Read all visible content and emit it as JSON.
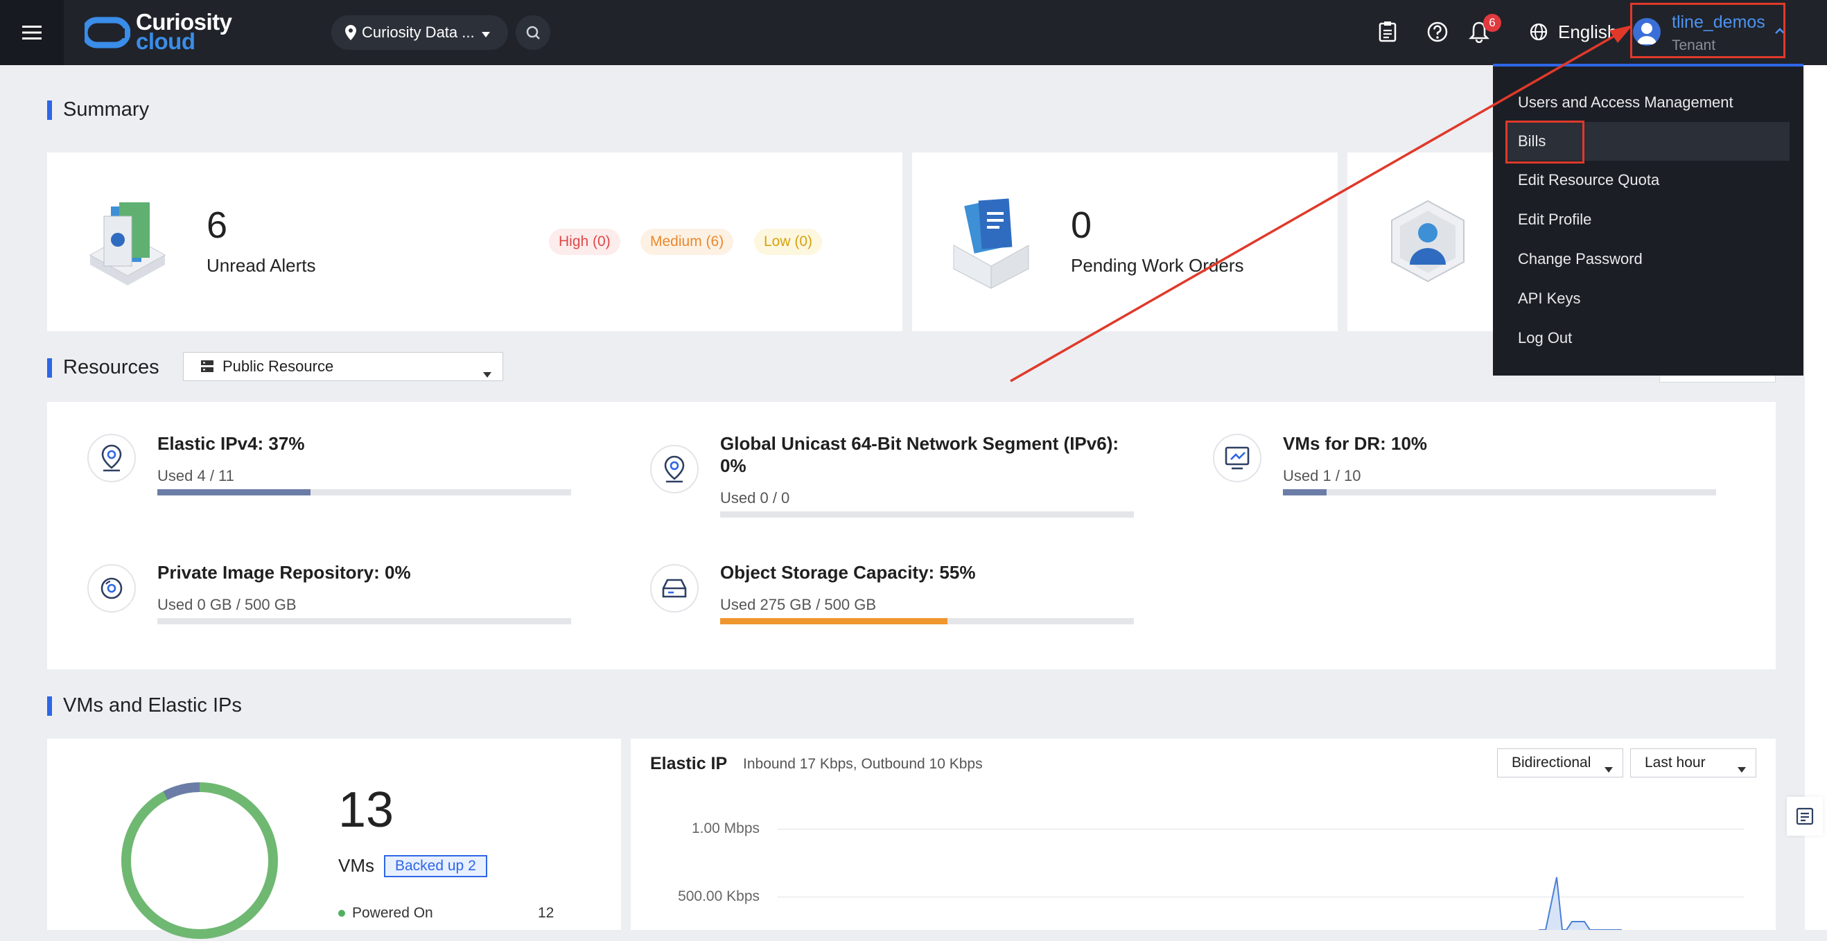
{
  "header": {
    "logo_line1": "Curiosity",
    "logo_line2": "cloud",
    "region": "Curiosity Data ...",
    "notification_count": "6",
    "language": "English",
    "user": {
      "name": "tline_demos",
      "role": "Tenant"
    }
  },
  "user_menu": {
    "items": [
      "Users and Access Management",
      "Bills",
      "Edit Resource Quota",
      "Edit Profile",
      "Change Password",
      "API Keys",
      "Log Out"
    ],
    "highlighted": "Bills"
  },
  "summary": {
    "title": "Summary",
    "alerts": {
      "count": "6",
      "label": "Unread Alerts",
      "high": "High (0)",
      "medium": "Medium (6)",
      "low": "Low (0)"
    },
    "work_orders": {
      "count": "0",
      "label": "Pending Work Orders"
    }
  },
  "resources": {
    "title": "Resources",
    "filter": "Public Resource",
    "items": [
      {
        "title": "Elastic IPv4: 37%",
        "used": "Used 4 / 11",
        "percent": 37
      },
      {
        "title": "Global Unicast 64-Bit Network Segment (IPv6):",
        "title2": "0%",
        "used": "Used 0 / 0",
        "percent": 0
      },
      {
        "title": "VMs for DR: 10%",
        "used": "Used 1 / 10",
        "percent": 10
      },
      {
        "title": "Private Image Repository: 0%",
        "used": "Used 0 GB / 500 GB",
        "percent": 0
      },
      {
        "title": "Object Storage Capacity: 55%",
        "used": "Used 275 GB / 500 GB",
        "percent": 55
      }
    ]
  },
  "vms": {
    "title": "VMs and Elastic IPs",
    "total": "13",
    "label": "VMs",
    "backed_up": "Backed up 2",
    "powered_on_label": "Powered On",
    "powered_on_count": "12",
    "donut": {
      "powered_on": 12,
      "other": 1
    }
  },
  "elastic_ip": {
    "title": "Elastic IP",
    "subtitle": "Inbound 17 Kbps, Outbound 10 Kbps",
    "direction": "Bidirectional",
    "range": "Last hour",
    "y_ticks": [
      "1.00 Mbps",
      "500.00 Kbps"
    ]
  },
  "colors": {
    "accent": "#2e66e6",
    "highlight": "#e0392a",
    "progress_default": "#6b7da6",
    "progress_warning": "#f0962e",
    "donut_green": "#6fb872"
  }
}
